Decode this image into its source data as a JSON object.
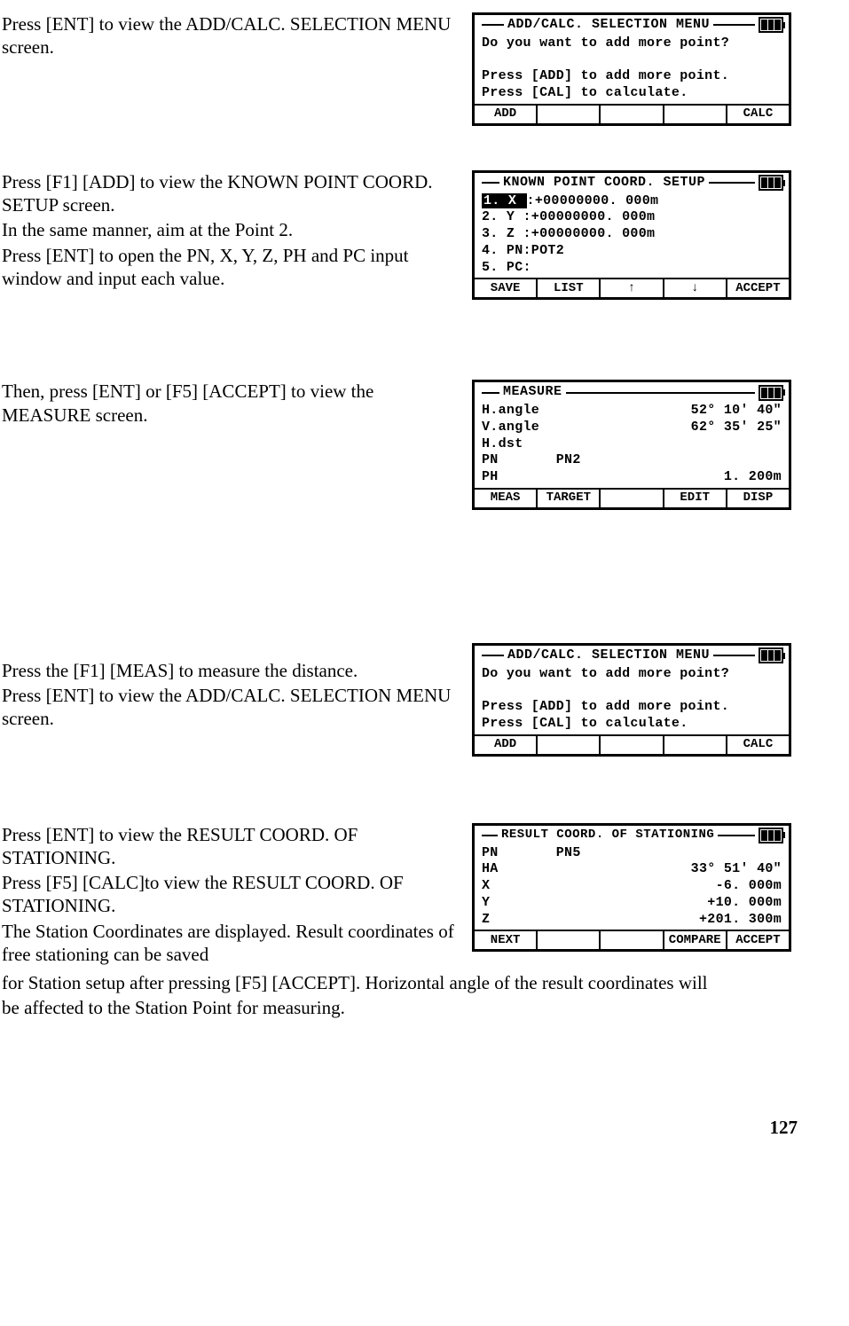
{
  "step1": {
    "text1": "Press [ENT] to view the ADD/CALC. SELECTION MENU screen.",
    "screen": {
      "title": "ADD/CALC. SELECTION MENU",
      "line1": "Do you want to add more point?",
      "line2": "Press [ADD] to add more point.",
      "line3": "Press [CAL] to calculate.",
      "sk1": "ADD",
      "sk2": "",
      "sk3": "",
      "sk4": "",
      "sk5": "CALC"
    }
  },
  "step2": {
    "text1": "Press [F1] [ADD] to view the KNOWN POINT COORD. SETUP screen.",
    "text2": "In the same manner, aim at the Point 2.",
    "text3": "Press [ENT] to open the PN, X, Y, Z, PH and PC input window and input each value.",
    "screen": {
      "title": "KNOWN POINT COORD. SETUP",
      "row1_lbl": "1. X ",
      "row1_val": ":+00000000. 000m",
      "row2": "2. Y :+00000000. 000m",
      "row3": "3. Z :+00000000. 000m",
      "row4": "4. PN:POT2",
      "row5": "5. PC:",
      "sk1": "SAVE",
      "sk2": "LIST",
      "sk3": "↑",
      "sk4": "↓",
      "sk5": "ACCEPT"
    }
  },
  "step3": {
    "text1": "Then, press [ENT] or [F5] [ACCEPT] to view the MEASURE screen.",
    "screen": {
      "title": "MEASURE",
      "r1l": "H.angle",
      "r1v": "52° 10′ 40″",
      "r2l": "V.angle",
      "r2v": "62° 35′ 25″",
      "r3l": "H.dst",
      "r3v": "",
      "r4l": "PN       PN2",
      "r4v": "",
      "r5l": "PH",
      "r5v": "1. 200m",
      "sk1": "MEAS",
      "sk2": "TARGET",
      "sk3": "",
      "sk4": "EDIT",
      "sk5": "DISP"
    }
  },
  "step4": {
    "text1": "Press the [F1] [MEAS] to measure the distance.",
    "text2": "Press [ENT] to view the ADD/CALC. SELECTION MENU screen.",
    "screen": {
      "title": "ADD/CALC. SELECTION MENU",
      "line1": "Do you want to add more point?",
      "line2": "Press [ADD] to add more point.",
      "line3": "Press [CAL] to calculate.",
      "sk1": "ADD",
      "sk2": "",
      "sk3": "",
      "sk4": "",
      "sk5": "CALC"
    }
  },
  "step5": {
    "text1": "Press [ENT] to view the RESULT COORD. OF STATIONING.",
    "text2": "Press [F5] [CALC]to view the RESULT COORD. OF STATIONING.",
    "text3": "The Station Coordinates are displayed. Result coordinates of free stationing can be saved",
    "after": {
      "l1": "for Station setup after pressing [F5] [ACCEPT]. Horizontal angle of the result coordinates will",
      "l2": "be affected to the Station Point for measuring."
    },
    "screen": {
      "title": "RESULT COORD. OF STATIONING",
      "r1l": "PN       PN5",
      "r1v": "",
      "r2l": "HA",
      "r2v": "33° 51′ 40″",
      "r3l": "X",
      "r3v": "-6. 000m",
      "r4l": "Y",
      "r4v": "+10. 000m",
      "r5l": "Z",
      "r5v": "+201. 300m",
      "sk1": "NEXT",
      "sk2": "",
      "sk3": "",
      "sk4": "COMPARE",
      "sk5": "ACCEPT"
    }
  },
  "pageNumber": "127"
}
